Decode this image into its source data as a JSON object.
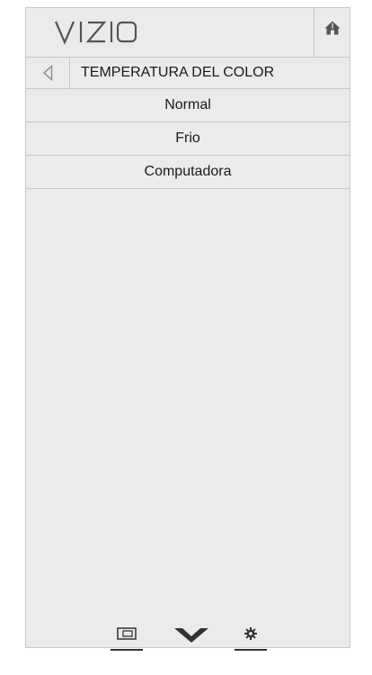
{
  "header": {
    "logo_text": "VIZIO",
    "home_icon": "home-icon"
  },
  "title_bar": {
    "back_icon": "back-arrow-icon",
    "title": "TEMPERATURA DEL COLOR"
  },
  "menu": {
    "items": [
      {
        "label": "Normal"
      },
      {
        "label": "Frio"
      },
      {
        "label": "Computadora"
      }
    ]
  },
  "bottom_nav": {
    "items": [
      {
        "icon": "picture-in-picture-icon"
      },
      {
        "icon": "vizio-v-icon"
      },
      {
        "icon": "gear-icon"
      }
    ]
  },
  "colors": {
    "panel_background": "#ebebeb",
    "divider": "#c8c8c8",
    "text": "#1a1a1a",
    "icon": "#555555"
  }
}
